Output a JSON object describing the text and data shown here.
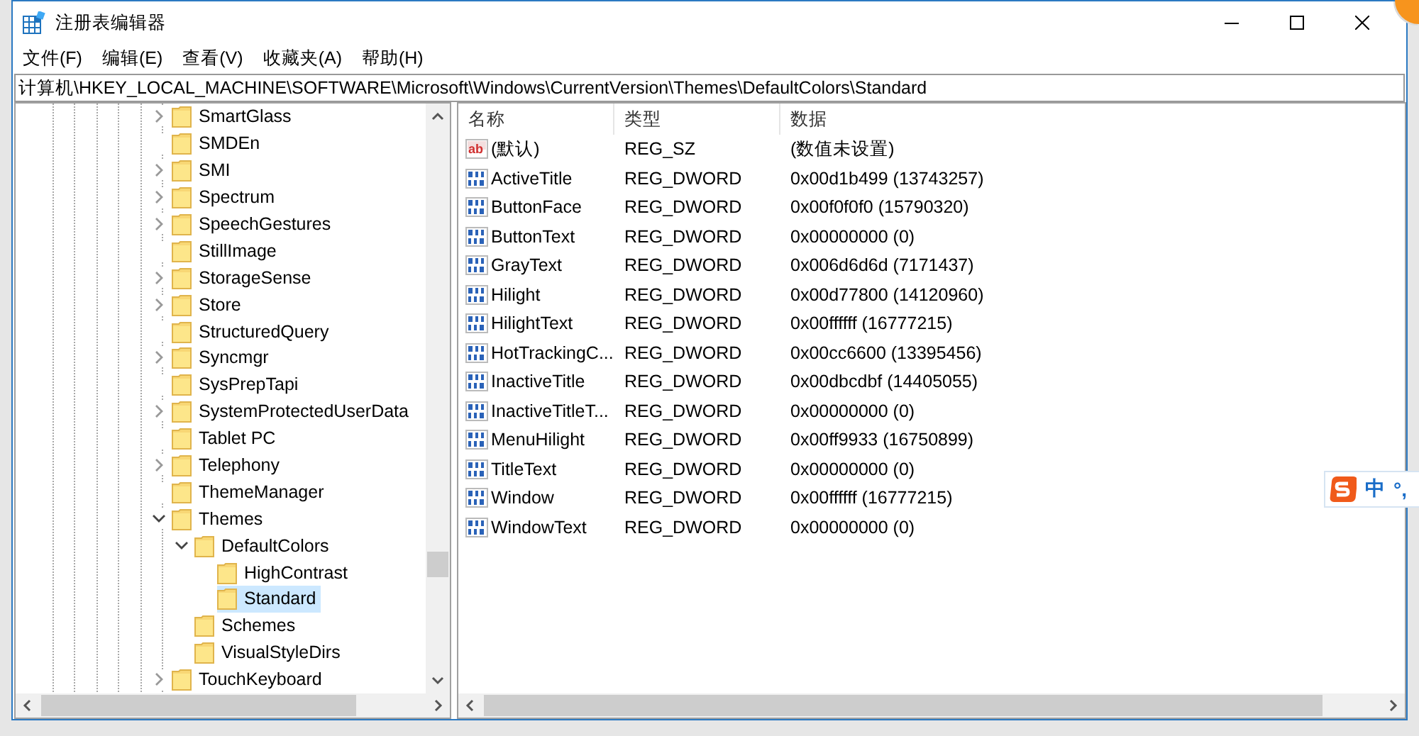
{
  "window": {
    "title": "注册表编辑器"
  },
  "menu": [
    "文件(F)",
    "编辑(E)",
    "查看(V)",
    "收藏夹(A)",
    "帮助(H)"
  ],
  "address": "计算机\\HKEY_LOCAL_MACHINE\\SOFTWARE\\Microsoft\\Windows\\CurrentVersion\\Themes\\DefaultColors\\Standard",
  "tree": [
    {
      "label": "SmartGlass",
      "expandable": true,
      "expanded": false,
      "selected": false
    },
    {
      "label": "SMDEn",
      "expandable": false,
      "selected": false
    },
    {
      "label": "SMI",
      "expandable": true,
      "expanded": false,
      "selected": false
    },
    {
      "label": "Spectrum",
      "expandable": true,
      "expanded": false,
      "selected": false
    },
    {
      "label": "SpeechGestures",
      "expandable": true,
      "expanded": false,
      "selected": false
    },
    {
      "label": "StillImage",
      "expandable": false,
      "selected": false
    },
    {
      "label": "StorageSense",
      "expandable": true,
      "expanded": false,
      "selected": false
    },
    {
      "label": "Store",
      "expandable": true,
      "expanded": false,
      "selected": false
    },
    {
      "label": "StructuredQuery",
      "expandable": false,
      "selected": false
    },
    {
      "label": "Syncmgr",
      "expandable": true,
      "expanded": false,
      "selected": false
    },
    {
      "label": "SysPrepTapi",
      "expandable": false,
      "selected": false
    },
    {
      "label": "SystemProtectedUserData",
      "expandable": true,
      "expanded": false,
      "selected": false
    },
    {
      "label": "Tablet PC",
      "expandable": false,
      "selected": false
    },
    {
      "label": "Telephony",
      "expandable": true,
      "expanded": false,
      "selected": false
    },
    {
      "label": "ThemeManager",
      "expandable": false,
      "selected": false
    },
    {
      "label": "Themes",
      "expandable": true,
      "expanded": true,
      "selected": false,
      "children": [
        {
          "label": "DefaultColors",
          "expandable": true,
          "expanded": true,
          "selected": false,
          "children": [
            {
              "label": "HighContrast",
              "expandable": false,
              "selected": false
            },
            {
              "label": "Standard",
              "expandable": false,
              "selected": true
            }
          ]
        },
        {
          "label": "Schemes",
          "expandable": false,
          "selected": false
        },
        {
          "label": "VisualStyleDirs",
          "expandable": false,
          "selected": false
        }
      ]
    },
    {
      "label": "TouchKeyboard",
      "expandable": true,
      "expanded": false,
      "selected": false
    }
  ],
  "table": {
    "columns": [
      "名称",
      "类型",
      "数据"
    ],
    "rows": [
      {
        "kind": "string",
        "icon_text": "ab",
        "name": "(默认)",
        "type": "REG_SZ",
        "data": "(数值未设置)"
      },
      {
        "kind": "dword",
        "name": "ActiveTitle",
        "type": "REG_DWORD",
        "data": "0x00d1b499 (13743257)"
      },
      {
        "kind": "dword",
        "name": "ButtonFace",
        "type": "REG_DWORD",
        "data": "0x00f0f0f0 (15790320)"
      },
      {
        "kind": "dword",
        "name": "ButtonText",
        "type": "REG_DWORD",
        "data": "0x00000000 (0)"
      },
      {
        "kind": "dword",
        "name": "GrayText",
        "type": "REG_DWORD",
        "data": "0x006d6d6d (7171437)"
      },
      {
        "kind": "dword",
        "name": "Hilight",
        "type": "REG_DWORD",
        "data": "0x00d77800 (14120960)"
      },
      {
        "kind": "dword",
        "name": "HilightText",
        "type": "REG_DWORD",
        "data": "0x00ffffff (16777215)"
      },
      {
        "kind": "dword",
        "name": "HotTrackingC...",
        "type": "REG_DWORD",
        "data": "0x00cc6600 (13395456)"
      },
      {
        "kind": "dword",
        "name": "InactiveTitle",
        "type": "REG_DWORD",
        "data": "0x00dbcdbf (14405055)"
      },
      {
        "kind": "dword",
        "name": "InactiveTitleT...",
        "type": "REG_DWORD",
        "data": "0x00000000 (0)"
      },
      {
        "kind": "dword",
        "name": "MenuHilight",
        "type": "REG_DWORD",
        "data": "0x00ff9933 (16750899)"
      },
      {
        "kind": "dword",
        "name": "TitleText",
        "type": "REG_DWORD",
        "data": "0x00000000 (0)"
      },
      {
        "kind": "dword",
        "name": "Window",
        "type": "REG_DWORD",
        "data": "0x00ffffff (16777215)"
      },
      {
        "kind": "dword",
        "name": "WindowText",
        "type": "REG_DWORD",
        "data": "0x00000000 (0)"
      }
    ]
  },
  "ime_toolbar": {
    "mode": "中",
    "punctuation": "°,"
  }
}
